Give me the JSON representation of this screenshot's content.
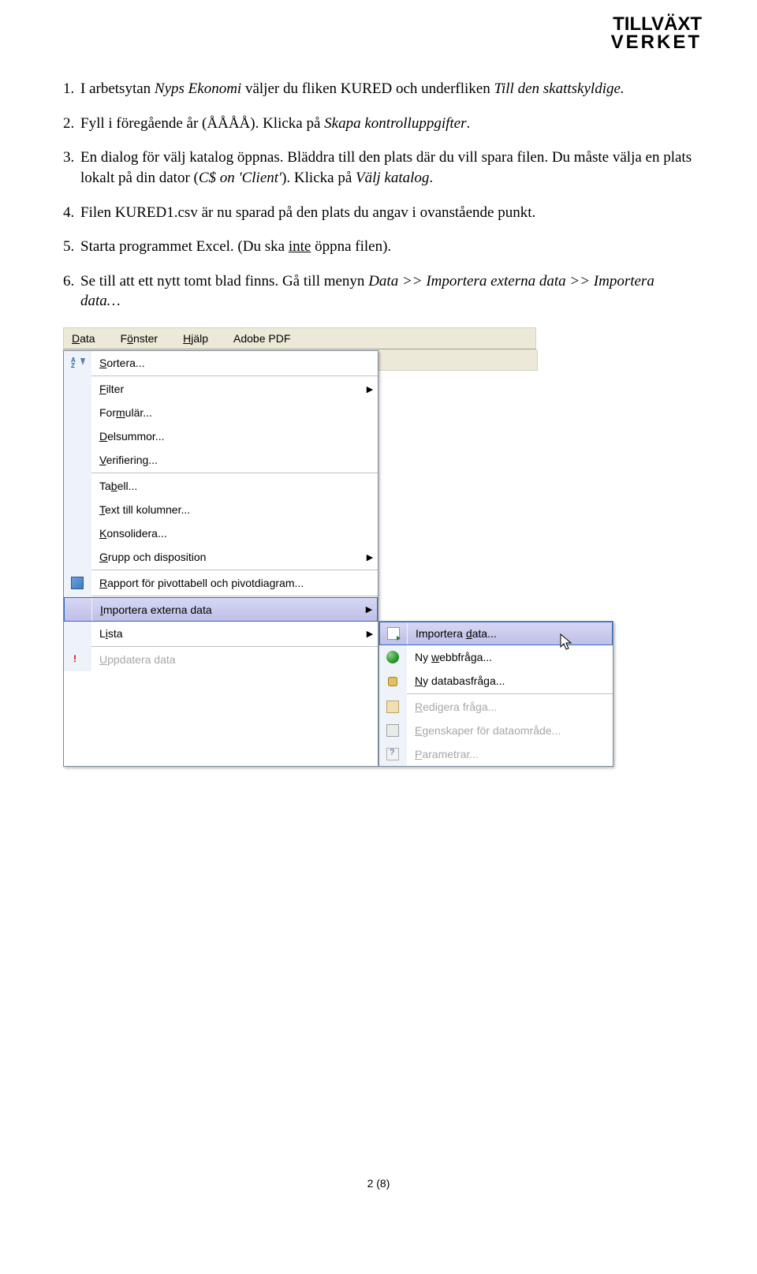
{
  "logo": {
    "line1": "TILLVÄXT",
    "line2": "VERKET"
  },
  "steps": {
    "s1": {
      "n": "1.",
      "a": "I arbetsytan ",
      "b": "Nyps Ekonomi",
      "c": " väljer du fliken KURED och underfliken ",
      "d": "Till den skattskyldige."
    },
    "s2": {
      "n": "2.",
      "a": "Fyll i föregående år (ÅÅÅÅ). Klicka på ",
      "b": "Skapa kontrolluppgifter",
      "c": "."
    },
    "s3": {
      "n": "3.",
      "a": "En dialog för välj katalog öppnas. Bläddra till den plats där du vill spara filen. Du måste välja en plats lokalt på din dator (",
      "b": "C$ on 'Client'",
      "c": "). Klicka på ",
      "d": "Välj katalog",
      "e": "."
    },
    "s4": {
      "n": "4.",
      "a": "Filen KURED1.csv är nu sparad på den plats du angav i ovanstående punkt."
    },
    "s5": {
      "n": "5.",
      "a": "Starta programmet Excel. (Du ska ",
      "u": "inte",
      "b": " öppna filen)."
    },
    "s6": {
      "n": "6.",
      "a": "Se till att ett nytt tomt blad finns. Gå till menyn ",
      "b": "Data >> Importera externa data >> Importera data…"
    }
  },
  "menubar": {
    "data": {
      "u": "D",
      "r": "ata"
    },
    "fonster": {
      "a": "F",
      "u": "ö",
      "b": "nster"
    },
    "hjalp": {
      "u": "H",
      "r": "jälp"
    },
    "adobe": "Adobe PDF"
  },
  "menu": {
    "sortera": {
      "u": "S",
      "r": "ortera..."
    },
    "filter": {
      "u": "F",
      "r": "ilter"
    },
    "formular": {
      "a": "For",
      "u": "m",
      "b": "ulär..."
    },
    "delsummor": {
      "u": "D",
      "r": "elsummor..."
    },
    "verifiering": {
      "u": "V",
      "r": "erifiering..."
    },
    "tabell": {
      "a": "Ta",
      "u": "b",
      "b": "ell..."
    },
    "textkol": {
      "u": "T",
      "r": "ext till kolumner..."
    },
    "konsolidera": {
      "u": "K",
      "r": "onsolidera..."
    },
    "grupp": {
      "u": "G",
      "r": "rupp och disposition"
    },
    "rapport": {
      "u": "R",
      "r": "apport för pivottabell och pivotdiagram..."
    },
    "importera": {
      "u": "I",
      "r": "mportera externa data"
    },
    "lista": {
      "a": "L",
      "u": "i",
      "b": "sta"
    },
    "uppdatera": {
      "u": "U",
      "r": "ppdatera data"
    }
  },
  "submenu": {
    "importdata": {
      "a": "Importera ",
      "u": "d",
      "b": "ata..."
    },
    "webb": {
      "a": "Ny ",
      "u": "w",
      "b": "ebbfråga..."
    },
    "db": {
      "u": "N",
      "r": "y databasfråga..."
    },
    "redigera": {
      "u": "R",
      "r": "edigera fråga..."
    },
    "egenskaper": {
      "u": "E",
      "r": "genskaper för dataområde..."
    },
    "param": {
      "u": "P",
      "r": "arametrar..."
    }
  },
  "pagenum": "2 (8)"
}
